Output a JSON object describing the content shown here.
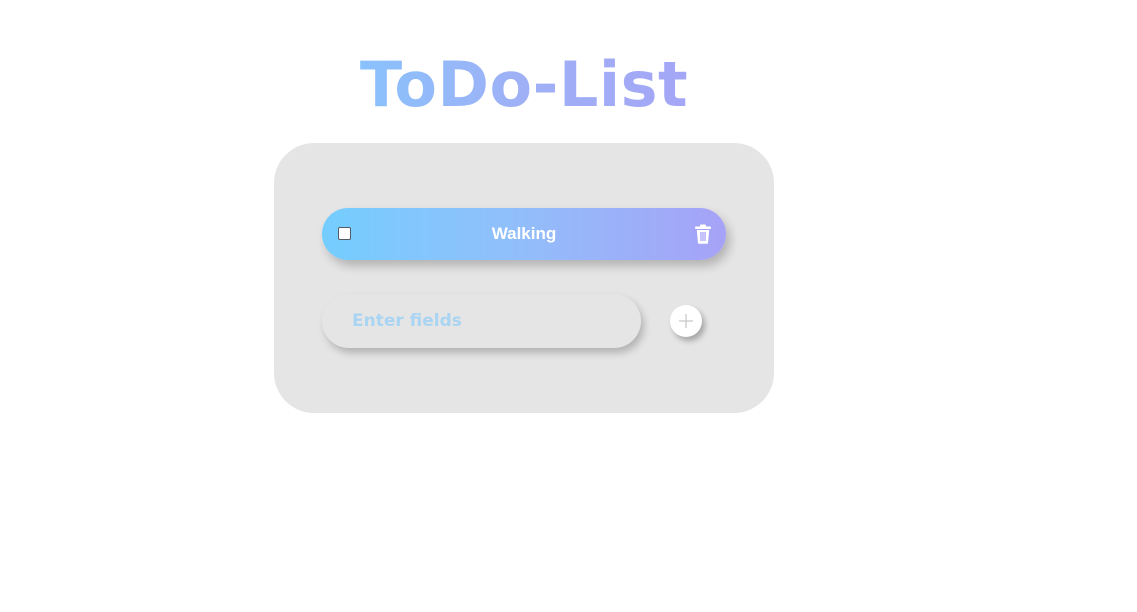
{
  "app": {
    "title": "ToDo-List"
  },
  "todos": [
    {
      "label": "Walking",
      "checked": false
    }
  ],
  "new_todo": {
    "placeholder": "Enter fields",
    "value": ""
  },
  "icons": {
    "delete": "trash-icon",
    "add": "plus-icon"
  },
  "colors": {
    "gradient_start": "#74cdff",
    "gradient_end": "#a6a2f7",
    "card_background": "#e6e5e6"
  }
}
